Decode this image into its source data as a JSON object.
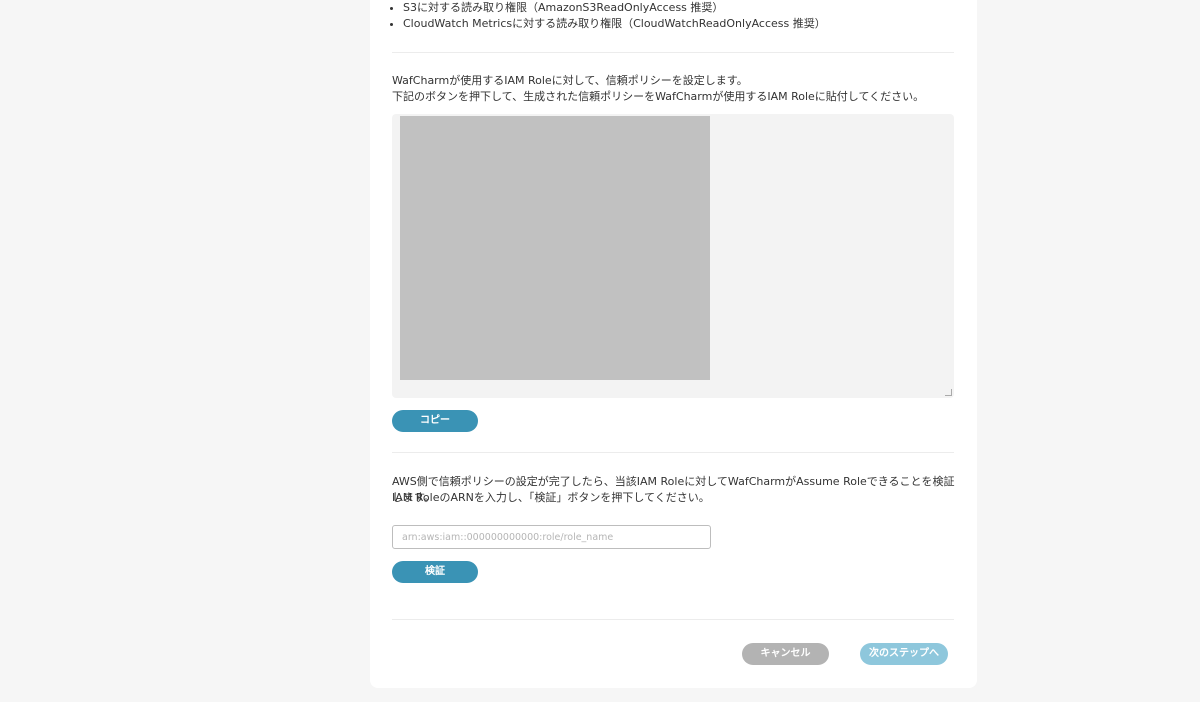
{
  "permissions": [
    "S3に対する読み取り権限（AmazonS3ReadOnlyAccess 推奨）",
    "CloudWatch Metricsに対する読み取り権限（CloudWatchReadOnlyAccess 推奨）"
  ],
  "trust_policy": {
    "line1": "WafCharmが使用するIAM Roleに対して、信頼ポリシーを設定します。",
    "line2": "下記のボタンを押下して、生成された信頼ポリシーをWafCharmが使用するIAM Roleに貼付してください。",
    "copy_label": "コピー"
  },
  "verify": {
    "line1": "AWS側で信頼ポリシーの設定が完了したら、当該IAM Roleに対してWafCharmがAssume Roleできることを検証します。",
    "line2": "IAM RoleのARNを入力し、「検証」ボタンを押下してください。",
    "arn_placeholder": "arn:aws:iam::000000000000:role/role_name",
    "arn_value": "",
    "verify_label": "検証"
  },
  "footer": {
    "cancel_label": "キャンセル",
    "next_label": "次のステップへ"
  },
  "colors": {
    "primary": "#3a93b5",
    "primary_disabled": "#8ec7dc",
    "cancel": "#b3b3b3"
  }
}
